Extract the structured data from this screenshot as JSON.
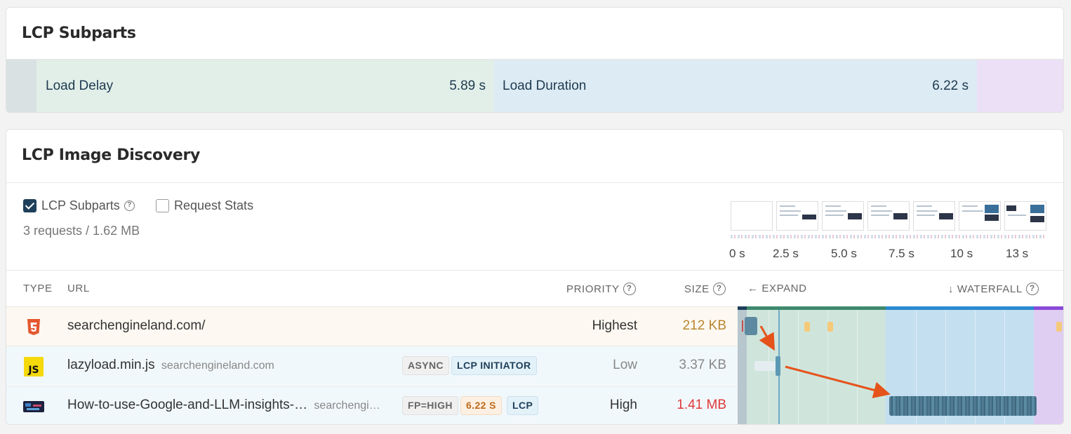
{
  "subparts_card": {
    "title": "LCP Subparts",
    "segments": [
      {
        "label": "Load Delay",
        "value": "5.89 s"
      },
      {
        "label": "Load Duration",
        "value": "6.22 s"
      }
    ],
    "colors": {
      "ttfb": "#d9e1e3",
      "load_delay": "#e2efe9",
      "load_duration": "#ddebf4",
      "render_delay": "#ece0f6"
    }
  },
  "discovery_card": {
    "title": "LCP Image Discovery",
    "controls": {
      "lcp_subparts_label": "LCP Subparts",
      "lcp_subparts_checked": true,
      "request_stats_label": "Request Stats",
      "request_stats_checked": false,
      "summary": "3 requests / 1.62 MB"
    },
    "filmstrip_ticks": [
      "0 s",
      "2.5 s",
      "5.0 s",
      "7.5 s",
      "10 s",
      "13 s"
    ],
    "table": {
      "headers": {
        "type": "TYPE",
        "url": "URL",
        "priority": "PRIORITY",
        "size": "SIZE",
        "expand": "← EXPAND",
        "waterfall": "↓ WATERFALL"
      },
      "rows": [
        {
          "type_icon": "html5-icon",
          "url": "searchengineland.com/",
          "domain": "",
          "badges": [],
          "priority": "Highest",
          "size": "212 KB",
          "size_color": "#b8862d"
        },
        {
          "type_icon": "js-icon",
          "url": "lazyload.min.js",
          "domain": "searchengineland.com",
          "badges": [
            "ASYNC",
            "LCP INITIATOR"
          ],
          "priority": "Low",
          "size": "3.37 KB",
          "size_color": "#888888"
        },
        {
          "type_icon": "image-icon",
          "url": "How-to-use-Google-and-LLM-insights-…",
          "domain": "searchengi…",
          "badges": [
            "FP=HIGH",
            "6.22 S",
            "LCP"
          ],
          "priority": "High",
          "size": "1.41 MB",
          "size_color": "#e03a3a"
        }
      ]
    }
  }
}
